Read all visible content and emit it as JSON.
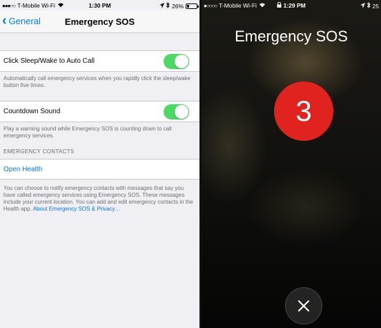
{
  "left": {
    "status": {
      "carrier": "T-Mobile Wi-Fi",
      "time": "1:30 PM",
      "battery": "26%",
      "battery_level": 0.26
    },
    "nav": {
      "back_label": "General",
      "title": "Emergency SOS"
    },
    "auto_call": {
      "label": "Click Sleep/Wake to Auto Call",
      "on": true,
      "footer": "Automatically call emergency services when you rapidly click the sleep/wake button five times."
    },
    "countdown": {
      "label": "Countdown Sound",
      "on": true,
      "footer": "Play a warning sound while Emergency SOS is counting down to call emergency services."
    },
    "contacts": {
      "header": "EMERGENCY CONTACTS",
      "open_health": "Open Health",
      "footer_text": "You can choose to notify emergency contacts with messages that say you have called emergency services using Emergency SOS. These messages include your current location. You can add and edit emergency contacts in the Health app. ",
      "footer_link": "About Emergency SOS & Privacy…"
    }
  },
  "right": {
    "status": {
      "carrier": "T-Mobile Wi-Fi",
      "time": "1:29 PM",
      "battery": "25"
    },
    "title": "Emergency SOS",
    "countdown_value": "3"
  },
  "colors": {
    "ios_blue": "#007aff",
    "toggle_green": "#4cd964",
    "sos_red": "#e0231f"
  }
}
